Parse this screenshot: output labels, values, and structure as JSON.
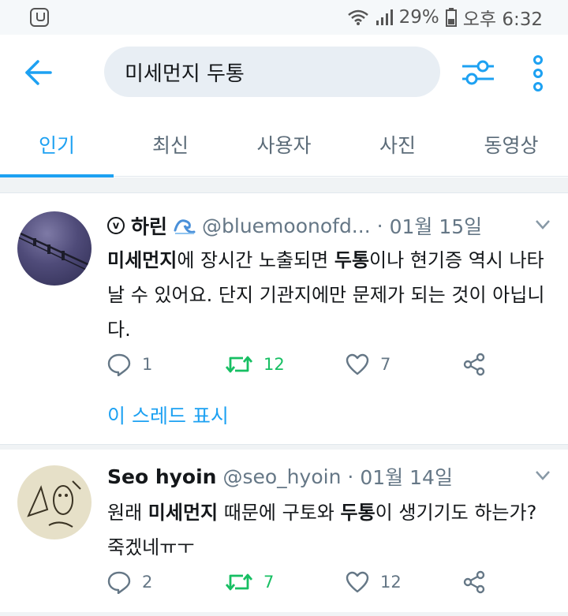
{
  "status_bar": {
    "battery": "29%",
    "time": "오후 6:32"
  },
  "header": {
    "search_value": "미세먼지 두통"
  },
  "tabs": [
    {
      "label": "인기",
      "active": true
    },
    {
      "label": "최신",
      "active": false
    },
    {
      "label": "사용자",
      "active": false
    },
    {
      "label": "사진",
      "active": false
    },
    {
      "label": "동영상",
      "active": false
    }
  ],
  "tweets": [
    {
      "verified_mark": "v",
      "name": "하린",
      "handle": "@bluemoonofd...",
      "date": "01월 15일",
      "text_parts": [
        "미세먼지",
        "에 장시간 노출되면 ",
        "두통",
        "이나 현기증 역시 나타날 수 있어요. 단지 기관지에만 문제가 되는 것이 아닙니다."
      ],
      "replies": "1",
      "retweets": "12",
      "likes": "7",
      "thread_link": "이 스레드 표시"
    },
    {
      "name": "Seo hyoin",
      "handle": "@seo_hyoin",
      "date": "01월 14일",
      "text_parts": [
        "원래 ",
        "미세먼지",
        " 때문에 구토와 ",
        "두통",
        "이 생기기도 하는가? 죽겠네ㅠㅜ"
      ],
      "replies": "2",
      "retweets": "7",
      "likes": "12"
    }
  ],
  "colors": {
    "accent": "#1da1f2",
    "retweet": "#17bf63",
    "muted": "#657786"
  }
}
